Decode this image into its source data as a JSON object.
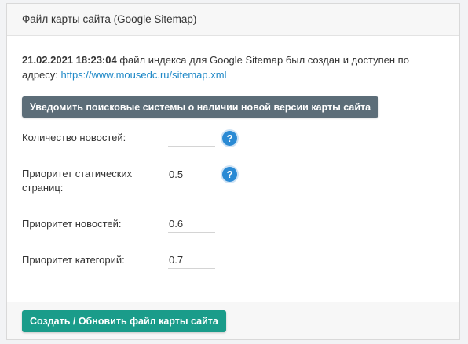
{
  "panel": {
    "title": "Файл карты сайта (Google Sitemap)"
  },
  "info": {
    "datetime": "21.02.2021 18:23:04",
    "text": " файл индекса для Google Sitemap был создан и доступен по адресу: ",
    "link": "https://www.mousedc.ru/sitemap.xml"
  },
  "notify_button": {
    "label": "Уведомить поисковые системы о наличии новой версии карты сайта"
  },
  "fields": [
    {
      "label": "Количество новостей:",
      "value": "",
      "help": "?"
    },
    {
      "label": "Приоритет статических страниц:",
      "value": "0.5",
      "help": "?"
    },
    {
      "label": "Приоритет новостей:",
      "value": "0.6"
    },
    {
      "label": "Приоритет категорий:",
      "value": "0.7"
    }
  ],
  "create_button": {
    "label": "Создать / Обновить файл карты сайта"
  },
  "colors": {
    "notify_button_bg": "#5c6d78",
    "create_button_bg": "#1a9c8a",
    "link": "#1e88c7",
    "help_icon_bg": "#2a8ad4"
  }
}
